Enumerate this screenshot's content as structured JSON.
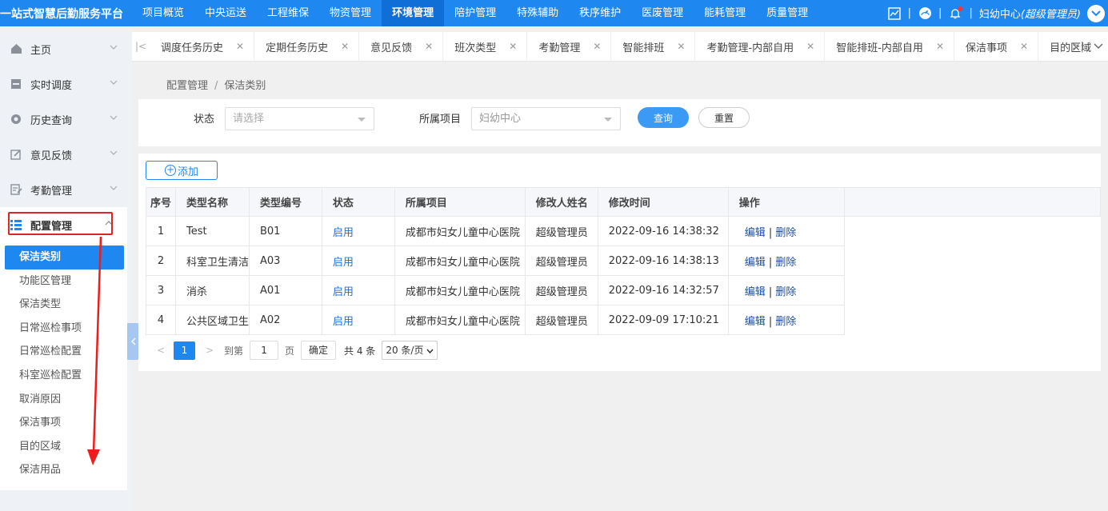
{
  "brand": "一站式智慧后勤服务平台",
  "topnav": [
    "项目概览",
    "中央运送",
    "工程维保",
    "物资管理",
    "环境管理",
    "陪护管理",
    "特殊辅助",
    "秩序维护",
    "医废管理",
    "能耗管理",
    "质量管理"
  ],
  "topnav_active": "环境管理",
  "user": {
    "name": "妇幼中心",
    "role": "(超级管理员)",
    "sep": "|"
  },
  "sidebar": {
    "groups": [
      {
        "label": "主页",
        "icon": "home-icon"
      },
      {
        "label": "实时调度",
        "icon": "dispatch-icon"
      },
      {
        "label": "历史查询",
        "icon": "history-icon"
      },
      {
        "label": "意见反馈",
        "icon": "feedback-icon"
      },
      {
        "label": "考勤管理",
        "icon": "attendance-icon"
      },
      {
        "label": "配置管理",
        "icon": "config-icon"
      }
    ],
    "submenu": [
      "保洁类别",
      "功能区管理",
      "保洁类型",
      "日常巡检事项",
      "日常巡检配置",
      "科室巡检配置",
      "取消原因",
      "保洁事项",
      "目的区域",
      "保洁用品"
    ],
    "submenu_active": "保洁类别"
  },
  "tabs": [
    "调度任务历史",
    "定期任务历史",
    "意见反馈",
    "班次类型",
    "考勤管理",
    "智能排班",
    "考勤管理-内部自用",
    "智能排班-内部自用",
    "保洁事项",
    "目的区域"
  ],
  "breadcrumb": {
    "parent": "配置管理",
    "sep": "/",
    "current": "保洁类别"
  },
  "filter": {
    "status_label": "状态",
    "status_placeholder": "请选择",
    "project_label": "所属项目",
    "project_value": "妇幼中心",
    "query_label": "查询",
    "reset_label": "重置"
  },
  "add_label": "添加",
  "table": {
    "headers": [
      "序号",
      "类型名称",
      "类型编号",
      "状态",
      "所属项目",
      "修改人姓名",
      "修改时间",
      "操作"
    ],
    "rows": [
      {
        "no": "1",
        "name": "Test",
        "code": "B01",
        "status": "启用",
        "project": "成都市妇女儿童中心医院",
        "modifier": "超级管理员",
        "time": "2022-09-16 14:38:32"
      },
      {
        "no": "2",
        "name": "科室卫生清洁",
        "code": "A03",
        "status": "启用",
        "project": "成都市妇女儿童中心医院",
        "modifier": "超级管理员",
        "time": "2022-09-16 14:38:13"
      },
      {
        "no": "3",
        "name": "消杀",
        "code": "A01",
        "status": "启用",
        "project": "成都市妇女儿童中心医院",
        "modifier": "超级管理员",
        "time": "2022-09-16 14:32:57"
      },
      {
        "no": "4",
        "name": "公共区域卫生",
        "code": "A02",
        "status": "启用",
        "project": "成都市妇女儿童中心医院",
        "modifier": "超级管理员",
        "time": "2022-09-09 17:10:21"
      }
    ],
    "edit_label": "编辑",
    "op_sep": "|",
    "delete_label": "删除"
  },
  "pager": {
    "current": "1",
    "goto_label": "到第",
    "goto_value": "1",
    "page_unit": "页",
    "confirm_label": "确定",
    "total_label": "共 4 条",
    "page_size": "20 条/页"
  }
}
